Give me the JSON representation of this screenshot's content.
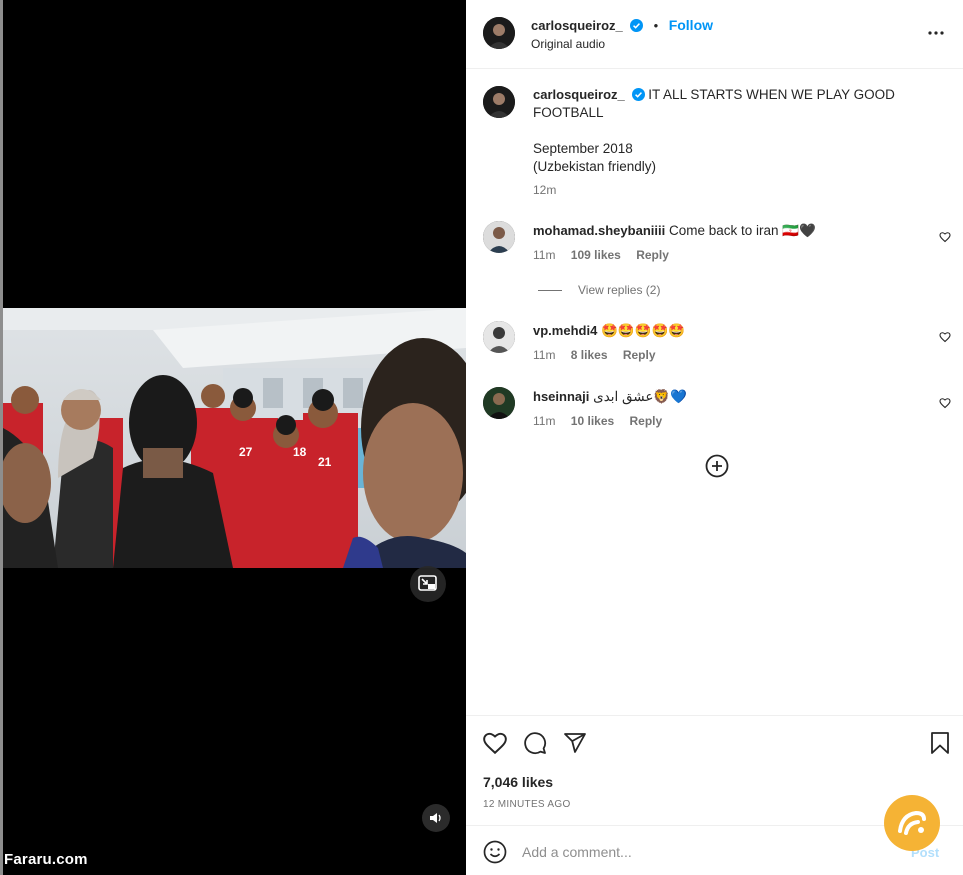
{
  "video": {
    "watermark": "Fararu.com"
  },
  "header": {
    "username": "carlosqueiroz_",
    "separator": "•",
    "follow_label": "Follow",
    "audio": "Original audio"
  },
  "caption": {
    "username": "carlosqueiroz_",
    "line1": "IT ALL STARTS WHEN WE PLAY GOOD FOOTBALL",
    "line2": "September 2018",
    "line3": "(Uzbekistan friendly)",
    "time": "12m"
  },
  "comments": [
    {
      "username": "mohamad.sheybaniiii",
      "text": "Come back to iran 🇮🇷🖤",
      "time": "11m",
      "likes": "109 likes",
      "reply": "Reply"
    },
    {
      "username": "vp.mehdi4",
      "text": "🤩🤩🤩🤩🤩",
      "time": "11m",
      "likes": "8 likes",
      "reply": "Reply"
    },
    {
      "username": "hseinnaji",
      "text": "عشق ابدی🦁💙",
      "time": "11m",
      "likes": "10 likes",
      "reply": "Reply"
    }
  ],
  "view_replies": "View replies (2)",
  "stats": {
    "likes": "7,046 likes",
    "date": "12 MINUTES AGO"
  },
  "comment_box": {
    "placeholder": "Add a comment...",
    "post_label": "Post"
  },
  "colors": {
    "accent": "#0095f6",
    "verified": "#0095f6",
    "muted": "#737373",
    "logo": "#f5b335"
  }
}
